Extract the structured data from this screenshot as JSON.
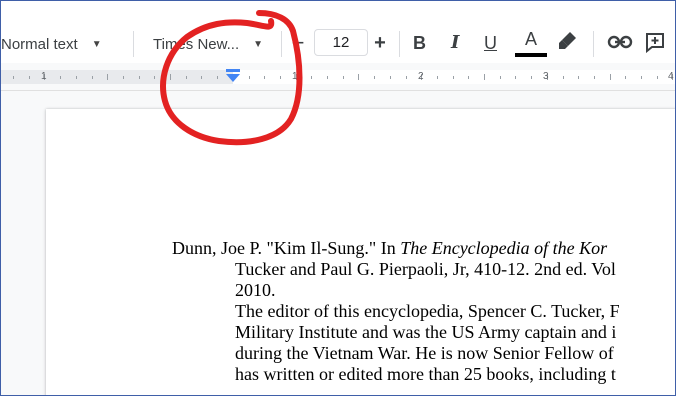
{
  "toolbar": {
    "style_select": "Normal text",
    "font_select": "Times New...",
    "font_size": "12",
    "decrease_label": "−",
    "increase_label": "+",
    "bold_label": "B",
    "italic_label": "I",
    "underline_label": "U",
    "text_color_label": "A",
    "text_color": "#000000"
  },
  "ruler": {
    "labels": [
      "1",
      "1",
      "2",
      "3",
      "4"
    ]
  },
  "document": {
    "lines": [
      "Dunn, Joe P. \"Kim Il-Sung.\" In ",
      "The Encyclopedia of the Kor",
      "Tucker and Paul G. Pierpaoli, Jr, 410-12. 2nd ed. Vol",
      "2010.",
      "The editor of this encyclopedia, Spencer C. Tucker, F",
      "Military Institute and was the US Army captain and i",
      "during the Vietnam War. He is now Senior Fellow of",
      "has written or edited more than 25 books, including t"
    ]
  },
  "annotation_color": "#e32222"
}
